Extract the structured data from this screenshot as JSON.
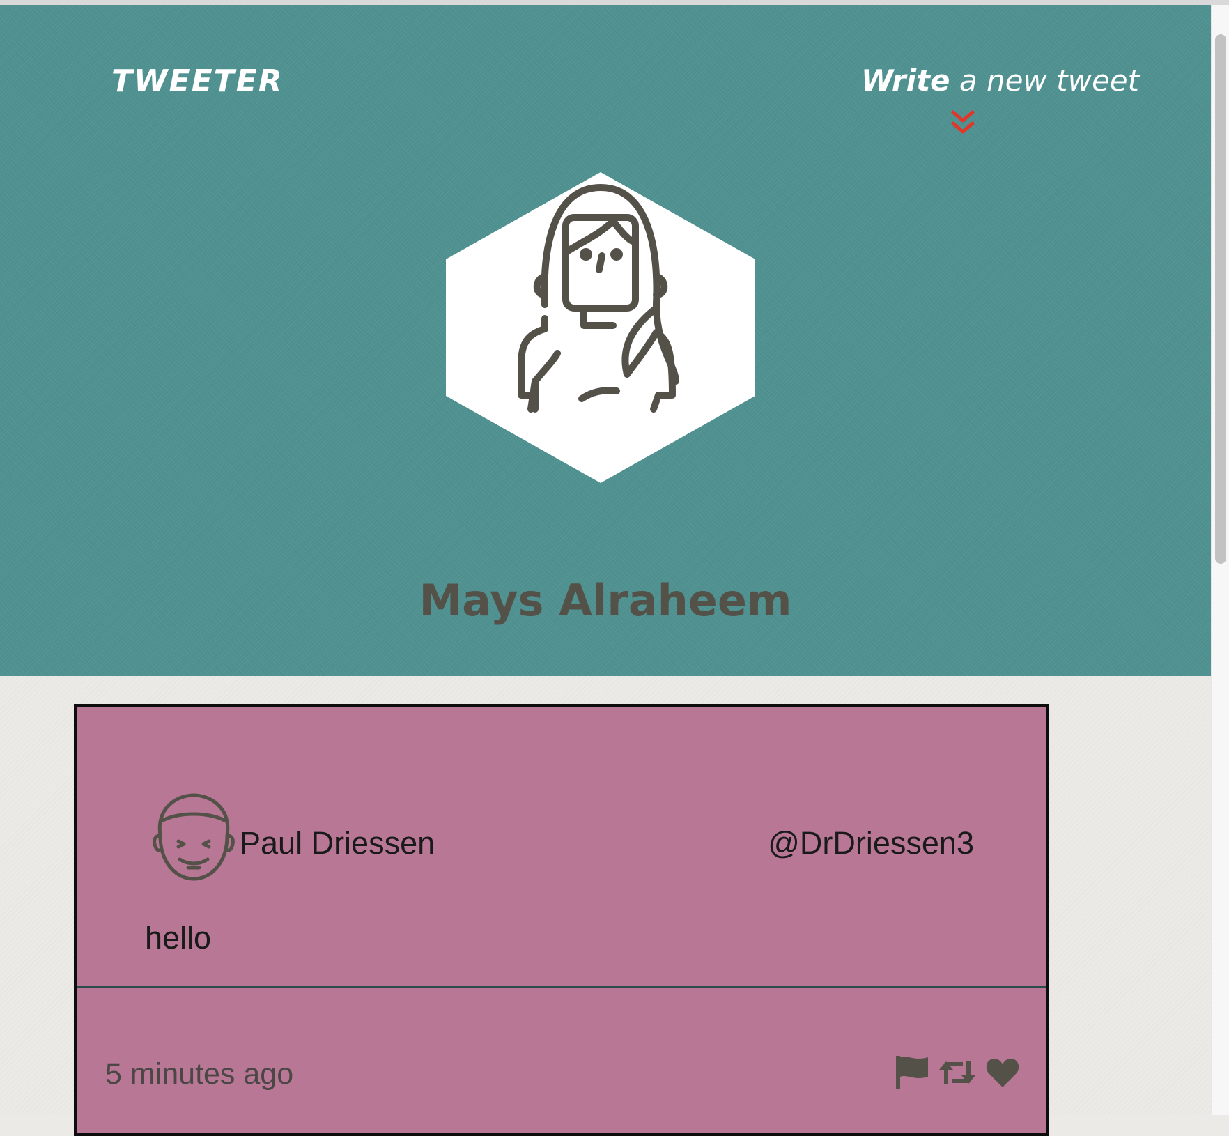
{
  "header": {
    "logo": "TWEETER",
    "compose": {
      "strong": "Write",
      "rest": " a new tweet"
    },
    "profile_name": "Mays Alraheem"
  },
  "tweets": [
    {
      "author_name": "Paul Driessen",
      "handle": "@DrDriessen3",
      "text": "hello",
      "time": "5 minutes ago",
      "actions": [
        "flag-icon",
        "retweet-icon",
        "heart-icon"
      ]
    }
  ],
  "colors": {
    "header_bg": "#4f9190",
    "tweet_bg": "#b77795",
    "page_bg": "#eceae6",
    "accent_arrow": "#e0372a",
    "icon_dark": "#545149"
  }
}
